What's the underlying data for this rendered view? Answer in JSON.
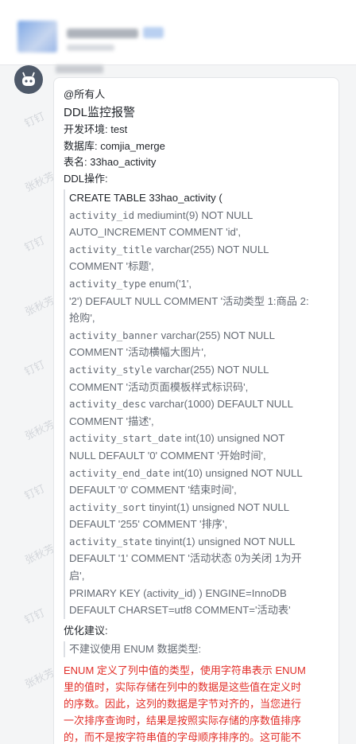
{
  "colors": {
    "background": "#f4f5f6",
    "bubble": "#ffffff",
    "text": "#1f2329",
    "muted": "#646a73",
    "warning": "#e22e28",
    "avatar": "#4e5969"
  },
  "header": {
    "icon": "blurred-group-avatar",
    "title_blurred": true
  },
  "sender": {
    "avatar_icon": "robot-icon",
    "name_blurred": true
  },
  "watermarks": [
    "钉钉",
    "张秋芳",
    "钉钉",
    "张秋芳",
    "钉钉",
    "张秋芳",
    "钉钉",
    "张秋芳",
    "钉钉",
    "张秋芳"
  ],
  "message": {
    "mention": "@所有人",
    "title": "DDL监控报警",
    "env": "开发环境: test",
    "database": "数据库: comjia_merge",
    "table": "表名: 33hao_activity",
    "ddl_label": "DDL操作:",
    "sql_lines": [
      {
        "mono": "",
        "text": "CREATE TABLE 33hao_activity ("
      },
      {
        "mono": "activity_id",
        "text": " mediumint(9) NOT NULL"
      },
      {
        "mono": "",
        "text": "AUTO_INCREMENT COMMENT 'id',"
      },
      {
        "mono": "activity_title",
        "text": " varchar(255) NOT NULL"
      },
      {
        "mono": "",
        "text": "COMMENT '标题',"
      },
      {
        "mono": "activity_type",
        "text": " enum('1',"
      },
      {
        "mono": "",
        "text": "'2') DEFAULT NULL COMMENT '活动类型 1:商品 2:"
      },
      {
        "mono": "",
        "text": "抢购',"
      },
      {
        "mono": "activity_banner",
        "text": " varchar(255) NOT NULL"
      },
      {
        "mono": "",
        "text": "COMMENT '活动横幅大图片',"
      },
      {
        "mono": "activity_style",
        "text": " varchar(255) NOT NULL"
      },
      {
        "mono": "",
        "text": "COMMENT '活动页面模板样式标识码',"
      },
      {
        "mono": "activity_desc",
        "text": " varchar(1000) DEFAULT NULL"
      },
      {
        "mono": "",
        "text": "COMMENT '描述',"
      },
      {
        "mono": "activity_start_date",
        "text": " int(10) unsigned NOT"
      },
      {
        "mono": "",
        "text": "NULL DEFAULT '0' COMMENT '开始时间',"
      },
      {
        "mono": "activity_end_date",
        "text": " int(10) unsigned NOT NULL"
      },
      {
        "mono": "",
        "text": "DEFAULT '0' COMMENT '结束时间',"
      },
      {
        "mono": "activity_sort",
        "text": " tinyint(1) unsigned NOT NULL"
      },
      {
        "mono": "",
        "text": "DEFAULT '255' COMMENT '排序',"
      },
      {
        "mono": "activity_state",
        "text": " tinyint(1) unsigned NOT NULL"
      },
      {
        "mono": "",
        "text": "DEFAULT '1' COMMENT '活动状态 0为关闭 1为开"
      },
      {
        "mono": "",
        "text": "启',"
      },
      {
        "mono": "",
        "text": "PRIMARY KEY (activity_id) ) ENGINE=InnoDB"
      },
      {
        "mono": "",
        "text": "DEFAULT CHARSET=utf8 COMMENT='活动表'"
      }
    ],
    "suggest_label": "优化建议:",
    "suggest_quote": "不建议使用 ENUM 数据类型:",
    "warning_lines": [
      "ENUM 定义了列中值的类型，使用字符串表示 ENUM",
      "里的值时，实际存储在列中的数据是这些值在定义时",
      "的序数。因此，这列的数据是字节对齐的，当您进行",
      "一次排序查询时，结果是按照实际存储的序数值排序",
      "的，而不是按字符串值的字母顺序排序的。这可能不"
    ]
  }
}
